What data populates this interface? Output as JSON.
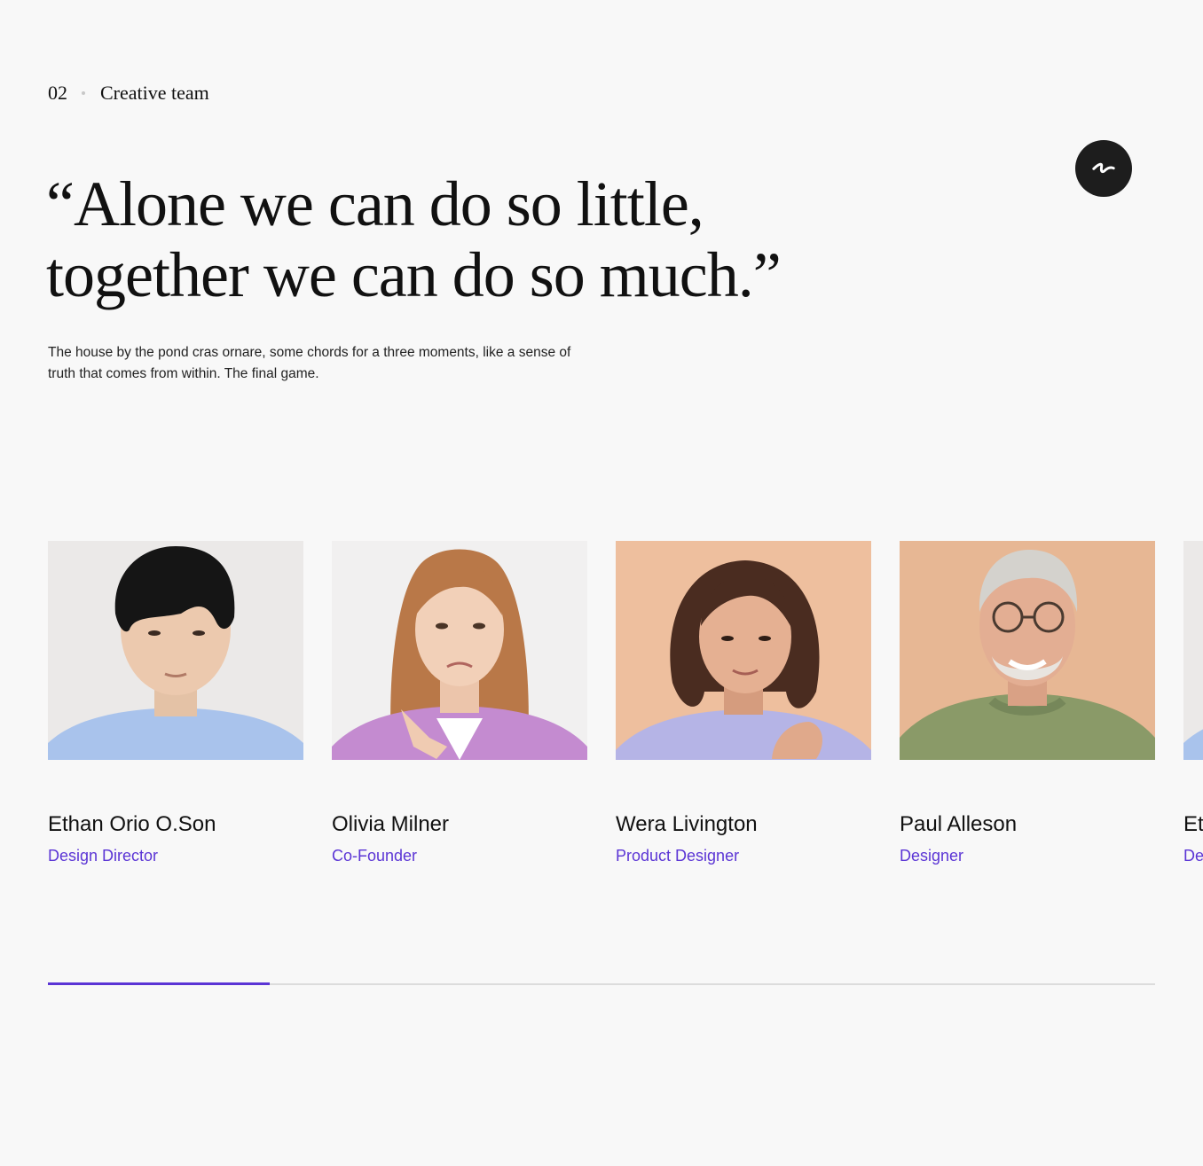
{
  "section": {
    "number": "02",
    "label": "Creative team"
  },
  "quote": {
    "line1": "“Alone we can do so little,",
    "line2": "together we can do so much.”"
  },
  "intro": "The house by the pond cras ornare, some chords for a three moments, like a sense of truth that comes from within. The final game.",
  "logo_icon": "squiggle-logo-icon",
  "team": [
    {
      "name": "Ethan Orio O.Son",
      "role": "Design Director"
    },
    {
      "name": "Olivia Milner",
      "role": "Co-Founder"
    },
    {
      "name": "Wera Livington",
      "role": "Product Designer"
    },
    {
      "name": "Paul Alleson",
      "role": "Designer"
    },
    {
      "name": "Ethan Orio O.Son",
      "role": "Design Director"
    }
  ],
  "slider_progress": 0.2,
  "colors": {
    "accent": "#5b35d5",
    "background": "#f8f8f8",
    "text": "#111111",
    "logo_bg": "#1d1d1d"
  }
}
